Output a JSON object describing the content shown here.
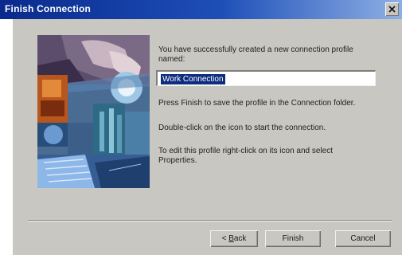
{
  "window": {
    "title": "Finish Connection"
  },
  "message": {
    "intro": "You have successfully created a new connection profile named:",
    "profile_name": "Work Connection",
    "line_folder": "Press Finish to save the profile in the Connection folder.",
    "line_start": "Double-click on the icon to start the connection.",
    "line_edit": "To edit this profile right-click on its icon and select Properties."
  },
  "buttons": {
    "back_prefix": "< ",
    "back_accel": "B",
    "back_rest": "ack",
    "finish": "Finish",
    "cancel": "Cancel"
  },
  "icons": {
    "close": "close-icon",
    "illustration": "wizard-collage"
  },
  "colors": {
    "titlebar_start": "#0a2a8c",
    "titlebar_end": "#8fb0e4",
    "dialog_face": "#c9c7c2",
    "selection": "#0f2d80"
  }
}
